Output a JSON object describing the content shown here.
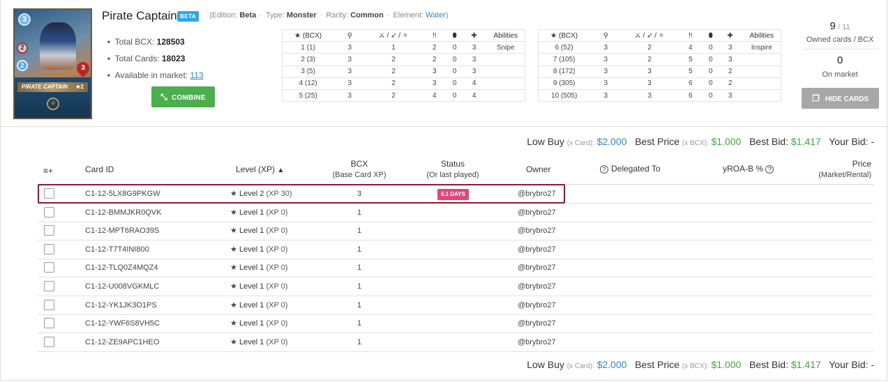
{
  "card": {
    "name": "Pirate Captain",
    "badge": "BETA",
    "plate_name": "PIRATE CAPTAIN",
    "plate_level": "★2",
    "mana": "3",
    "attack": "2",
    "speed": "2",
    "health": "3",
    "meta": {
      "edition_label": "(Edition:",
      "edition": "Beta",
      "type_label": "Type:",
      "type": "Monster",
      "rarity_label": "Rarity:",
      "rarity": "Common",
      "element_label": "Element:",
      "element": "Water",
      "close": ")"
    },
    "total_bcx_label": "Total BCX:",
    "total_bcx": "128503",
    "total_cards_label": "Total Cards:",
    "total_cards": "18023",
    "available_label": "Available in market:",
    "available": "113",
    "combine_label": "COMBINE"
  },
  "level_table_headers": [
    "★ (BCX)",
    "⚲",
    "⚔ / ➶ / ✧",
    "!!",
    "⬮",
    "✚",
    "Abilities"
  ],
  "level_table_left": [
    [
      "1 (1)",
      "3",
      "1",
      "2",
      "0",
      "3",
      "Snipe"
    ],
    [
      "2 (3)",
      "3",
      "2",
      "2",
      "0",
      "3",
      ""
    ],
    [
      "3 (5)",
      "3",
      "2",
      "3",
      "0",
      "3",
      ""
    ],
    [
      "4 (12)",
      "3",
      "2",
      "3",
      "0",
      "4",
      ""
    ],
    [
      "5 (25)",
      "3",
      "2",
      "4",
      "0",
      "4",
      ""
    ]
  ],
  "level_table_right": [
    [
      "6 (52)",
      "3",
      "2",
      "4",
      "0",
      "3",
      "Inspire"
    ],
    [
      "7 (105)",
      "3",
      "2",
      "5",
      "0",
      "3",
      ""
    ],
    [
      "8 (172)",
      "3",
      "3",
      "5",
      "0",
      "2",
      ""
    ],
    [
      "9 (305)",
      "3",
      "3",
      "6",
      "0",
      "2",
      ""
    ],
    [
      "10 (505)",
      "3",
      "3",
      "6",
      "0",
      "3",
      ""
    ]
  ],
  "owned": {
    "count": "9",
    "total": "/ 11",
    "label": "Owned cards / BCX",
    "market_count": "0",
    "market_label": "On market",
    "hide_label": "HIDE CARDS"
  },
  "prices": {
    "low_buy_label": "Low Buy",
    "low_buy_note": "(x Card):",
    "low_buy": "$2.000",
    "best_price_label": "Best Price",
    "best_price_note": "(x BCX):",
    "best_price": "$1.000",
    "best_bid_label": "Best Bid:",
    "best_bid": "$1.417",
    "your_bid_label": "Your Bid:",
    "your_bid": "-"
  },
  "table": {
    "columns": {
      "select": "≡+",
      "card_id": "Card ID",
      "level": "Level (XP)",
      "bcx": "BCX",
      "bcx_sub": "(Base Card XP)",
      "status": "Status",
      "status_sub": "(Or last played)",
      "owner": "Owner",
      "delegated": "Delegated To",
      "yroa": "yROA-B %",
      "price": "Price",
      "price_sub": "(Market/Rental)"
    },
    "rows": [
      {
        "id": "C1-12-5LX8G9PKGW",
        "level": "Level 2",
        "xp": "(XP 30)",
        "bcx": "3",
        "status": "6.1 DAYS",
        "owner": "@brybro27"
      },
      {
        "id": "C1-12-BMMJKR0QVK",
        "level": "Level 1",
        "xp": "(XP 0)",
        "bcx": "1",
        "status": "",
        "owner": "@brybro27"
      },
      {
        "id": "C1-12-MPT6RAO39S",
        "level": "Level 1",
        "xp": "(XP 0)",
        "bcx": "1",
        "status": "",
        "owner": "@brybro27"
      },
      {
        "id": "C1-12-T7T4INI800",
        "level": "Level 1",
        "xp": "(XP 0)",
        "bcx": "1",
        "status": "",
        "owner": "@brybro27"
      },
      {
        "id": "C1-12-TLQ0Z4MQZ4",
        "level": "Level 1",
        "xp": "(XP 0)",
        "bcx": "1",
        "status": "",
        "owner": "@brybro27"
      },
      {
        "id": "C1-12-U008VGKMLC",
        "level": "Level 1",
        "xp": "(XP 0)",
        "bcx": "1",
        "status": "",
        "owner": "@brybro27"
      },
      {
        "id": "C1-12-YK1JK3O1PS",
        "level": "Level 1",
        "xp": "(XP 0)",
        "bcx": "1",
        "status": "",
        "owner": "@brybro27"
      },
      {
        "id": "C1-12-YWF6S8VH5C",
        "level": "Level 1",
        "xp": "(XP 0)",
        "bcx": "1",
        "status": "",
        "owner": "@brybro27"
      },
      {
        "id": "C1-12-ZE9APC1HEO",
        "level": "Level 1",
        "xp": "(XP 0)",
        "bcx": "1",
        "status": "",
        "owner": "@brybro27"
      }
    ]
  },
  "colors": {
    "accent_green": "#3ea83a",
    "link_blue": "#2e86c8",
    "combine_button": "#4cae4c",
    "status_badge": "#e0457b",
    "highlight_border": "#8b1a2c"
  }
}
